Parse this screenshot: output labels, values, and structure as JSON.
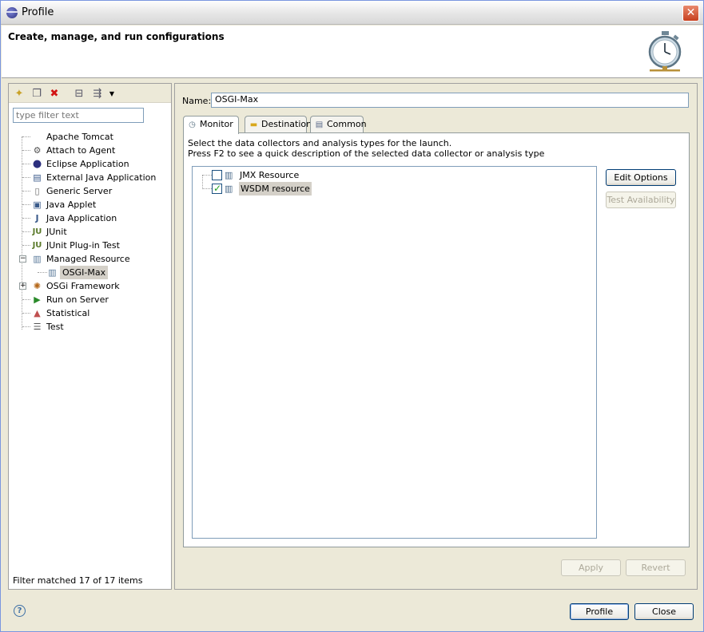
{
  "window": {
    "title": "Profile",
    "close_glyph": "✕"
  },
  "header": {
    "heading": "Create, manage, and run configurations"
  },
  "left_panel": {
    "filter_placeholder": "type filter text",
    "tree": [
      {
        "label": "Apache Tomcat",
        "icon": "tomcat-icon"
      },
      {
        "label": "Attach to Agent",
        "icon": "agent-icon"
      },
      {
        "label": "Eclipse Application",
        "icon": "eclipse-icon"
      },
      {
        "label": "External Java Application",
        "icon": "external-java-icon"
      },
      {
        "label": "Generic Server",
        "icon": "server-icon"
      },
      {
        "label": "Java Applet",
        "icon": "applet-icon"
      },
      {
        "label": "Java Application",
        "icon": "java-app-icon"
      },
      {
        "label": "JUnit",
        "icon": "junit-icon"
      },
      {
        "label": "JUnit Plug-in Test",
        "icon": "junit-plugin-icon"
      },
      {
        "label": "Managed Resource",
        "icon": "managed-resource-icon",
        "expanded": true
      },
      {
        "label": "OSGI-Max",
        "icon": "resource-icon",
        "child": true,
        "selected": true
      },
      {
        "label": "OSGi Framework",
        "icon": "osgi-icon",
        "collapsed": true
      },
      {
        "label": "Run on Server",
        "icon": "run-server-icon"
      },
      {
        "label": "Statistical",
        "icon": "statistical-icon"
      },
      {
        "label": "Test",
        "icon": "test-icon"
      }
    ],
    "filter_status": "Filter matched 17 of 17 items"
  },
  "right_panel": {
    "name_label": "Name:",
    "name_value": "OSGI-Max",
    "tabs": [
      {
        "label": "Monitor",
        "icon": "stopwatch-icon",
        "active": true
      },
      {
        "label": "Destination",
        "icon": "folder-icon"
      },
      {
        "label": "Common",
        "icon": "common-icon"
      }
    ],
    "description_line1": "Select the data collectors and analysis types for the launch.",
    "description_line2": "Press F2 to see a quick description of the selected data collector or analysis type",
    "collectors": [
      {
        "label": "JMX Resource",
        "checked": false
      },
      {
        "label": "WSDM resource",
        "checked": true,
        "selected": true
      }
    ],
    "edit_options": "Edit Options",
    "test_availability": "Test Availability",
    "apply": "Apply",
    "revert": "Revert"
  },
  "footer": {
    "profile": "Profile",
    "close": "Close",
    "help_glyph": "?"
  }
}
